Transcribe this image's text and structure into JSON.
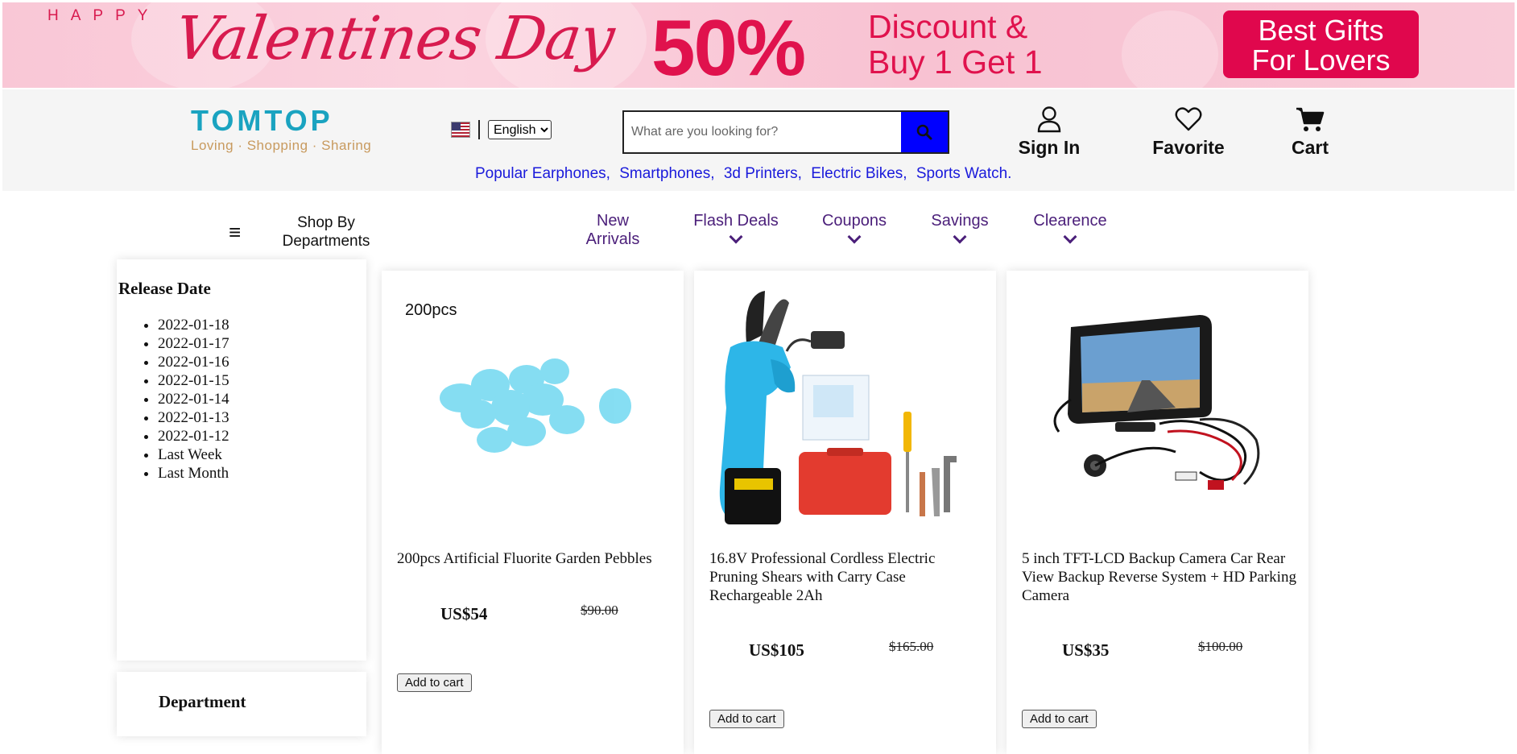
{
  "banner": {
    "happy": "HAPPY",
    "valentine": "Valentines Day",
    "discount_pct": "50%",
    "discount_line1": "Discount &",
    "discount_line2": "Buy 1 Get 1",
    "gift_line1": "Best Gifts",
    "gift_line2": "For Lovers",
    "colors": {
      "accent": "#e0124d",
      "background": "#f9c7d6"
    }
  },
  "header": {
    "logo_word": "TOMTOP",
    "logo_tagline": "Loving · Shopping · Sharing",
    "language": {
      "selected": "English",
      "options": [
        "English"
      ]
    },
    "search": {
      "placeholder": "What are you looking for?",
      "button_color": "#0000ff"
    },
    "icons": {
      "sign_in": "Sign In",
      "favorite": "Favorite",
      "cart": "Cart"
    },
    "popular_links": [
      "Popular Earphones,",
      "Smartphones,",
      "3d Printers,",
      "Electric Bikes,",
      "Sports Watch."
    ]
  },
  "nav": {
    "departments": "Shop By Departments",
    "items": [
      {
        "label": "New Arrivals",
        "dropdown": false
      },
      {
        "label": "Flash Deals",
        "dropdown": true
      },
      {
        "label": "Coupons",
        "dropdown": true
      },
      {
        "label": "Savings",
        "dropdown": true
      },
      {
        "label": "Clearence",
        "dropdown": true
      }
    ]
  },
  "sidebar": {
    "release_title": "Release Date",
    "release_dates": [
      "2022-01-18",
      "2022-01-17",
      "2022-01-16",
      "2022-01-15",
      "2022-01-14",
      "2022-01-13",
      "2022-01-12",
      "Last Week",
      "Last Month"
    ],
    "department_title": "Department"
  },
  "products": [
    {
      "badge": "200pcs",
      "title": "200pcs Artificial Fluorite Garden Pebbles",
      "price": "US$54",
      "old_price": "$90.00",
      "add_label": "Add to cart",
      "image_icon": "pebbles-icon"
    },
    {
      "badge": "",
      "title": "16.8V Professional Cordless Electric Pruning Shears with Carry Case Rechargeable 2Ah",
      "price": "US$105",
      "old_price": "$165.00",
      "add_label": "Add to cart",
      "image_icon": "pruning-shears-icon"
    },
    {
      "badge": "",
      "title": "5 inch TFT-LCD Backup Camera Car Rear View Backup Reverse System + HD Parking Camera",
      "price": "US$35",
      "old_price": "$100.00",
      "add_label": "Add to cart",
      "image_icon": "backup-camera-icon"
    }
  ]
}
